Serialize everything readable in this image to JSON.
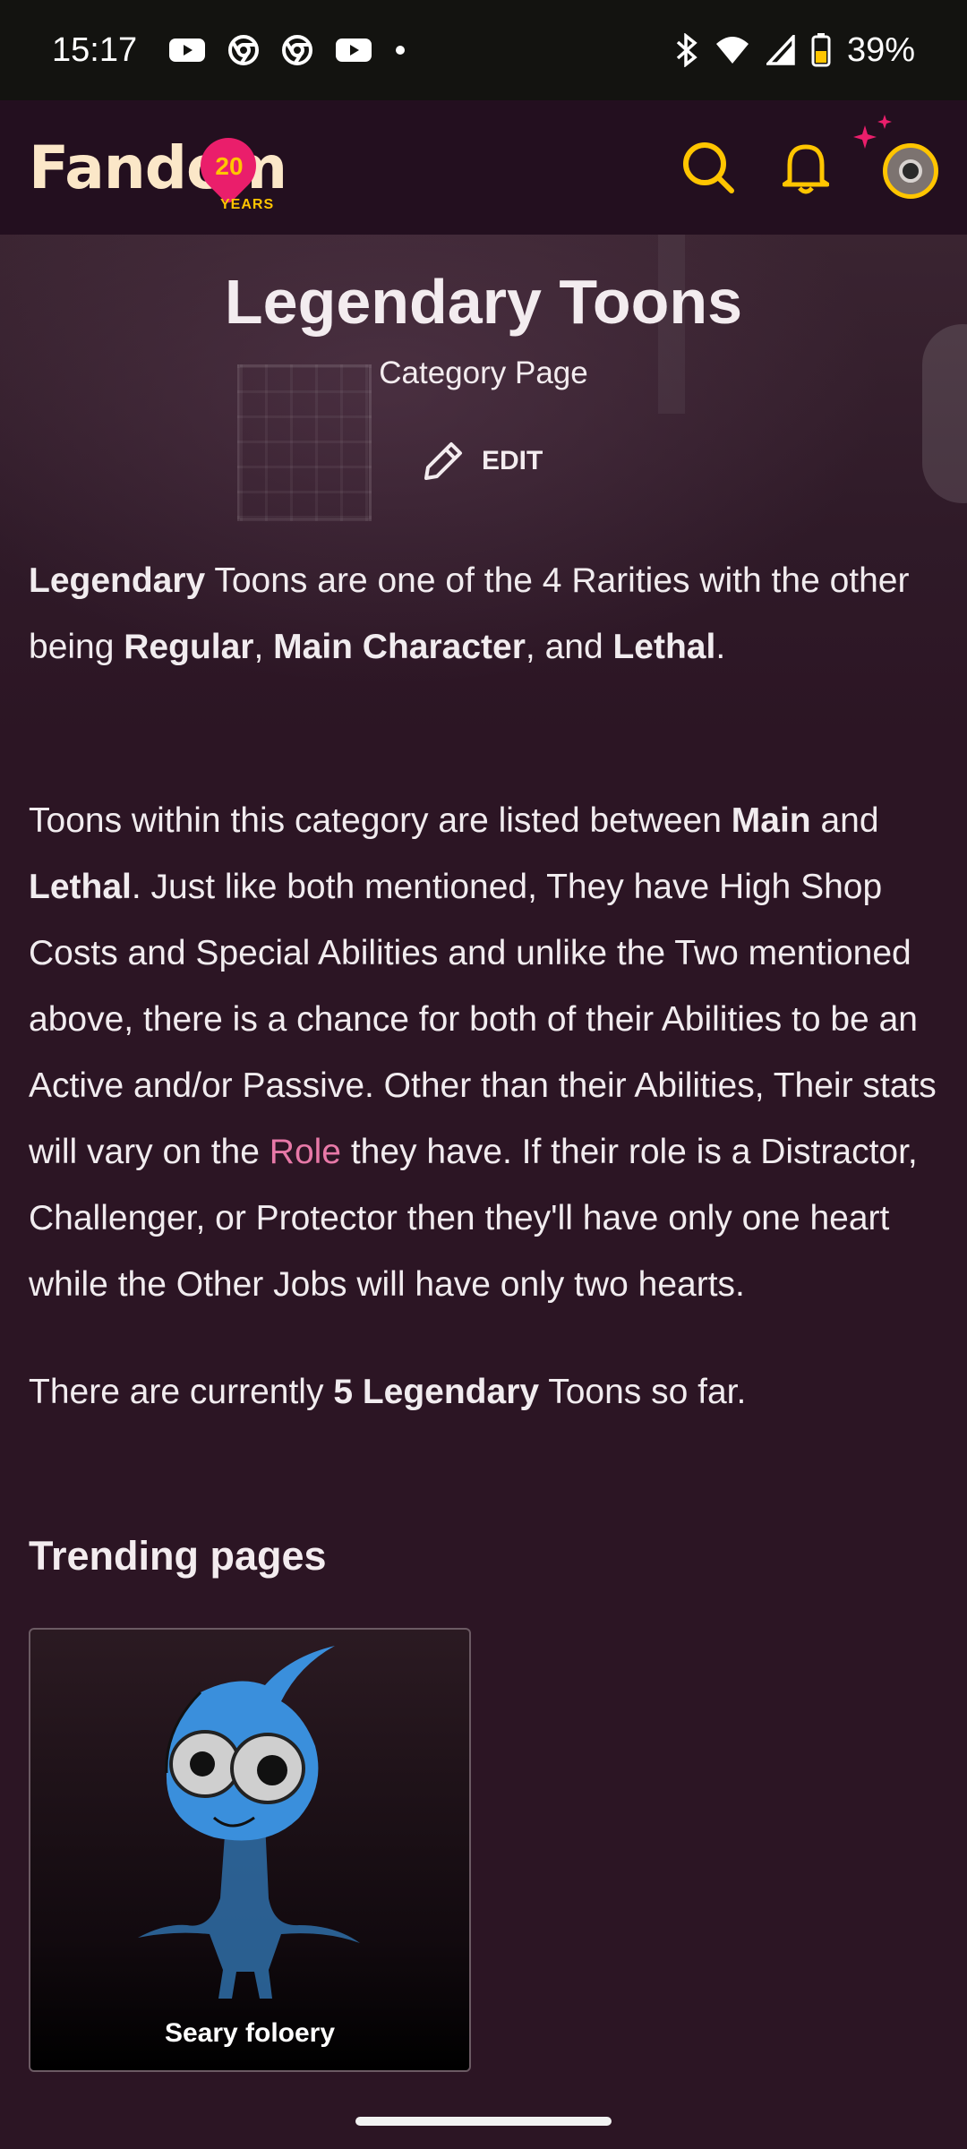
{
  "status_bar": {
    "time": "15:17",
    "battery": "39%",
    "left_icons": [
      "youtube-icon",
      "chrome-icon",
      "chrome-icon",
      "youtube-icon",
      "dot-icon"
    ],
    "right_icons": [
      "bluetooth-icon",
      "wifi-icon",
      "signal-icon",
      "battery-icon"
    ]
  },
  "nav": {
    "logo_text": "Fandom",
    "logo_badge": "20",
    "logo_years": "YEARS",
    "accent": "#ffc500"
  },
  "header": {
    "title": "Legendary Toons",
    "subtitle": "Category Page",
    "edit_label": "EDIT"
  },
  "article": {
    "p1": {
      "b1": "Legendary",
      "t1": " Toons are one of the 4 Rarities with the other being ",
      "b2": "Regular",
      "t2": ", ",
      "b3": "Main Character",
      "t3": ", and ",
      "b4": "Lethal",
      "t4": "."
    },
    "p2": {
      "t1": "Toons within this category are listed between ",
      "b1": "Main",
      "t2": " and ",
      "b2": "Lethal",
      "t3": ". Just like both mentioned, They have High Shop Costs and Special Abilities and unlike the Two mentioned above, there is a chance for both of their Abilities to be an Active and/or Passive. Other than their Abilities, Their stats will vary on the ",
      "link": "Role",
      "t4": " they have. If their role is a Distractor, Challenger, or Protector then they'll have only one heart while the Other Jobs will have only two hearts."
    },
    "p3": {
      "t1": "There are currently ",
      "b1": "5 Legendary",
      "t2": " Toons so far."
    }
  },
  "trending": {
    "heading": "Trending pages",
    "items": [
      {
        "label": "Seary foloery"
      }
    ]
  },
  "colors": {
    "background": "#2c1524",
    "link": "#e879a8",
    "brand_pink": "#ea1e6b"
  }
}
